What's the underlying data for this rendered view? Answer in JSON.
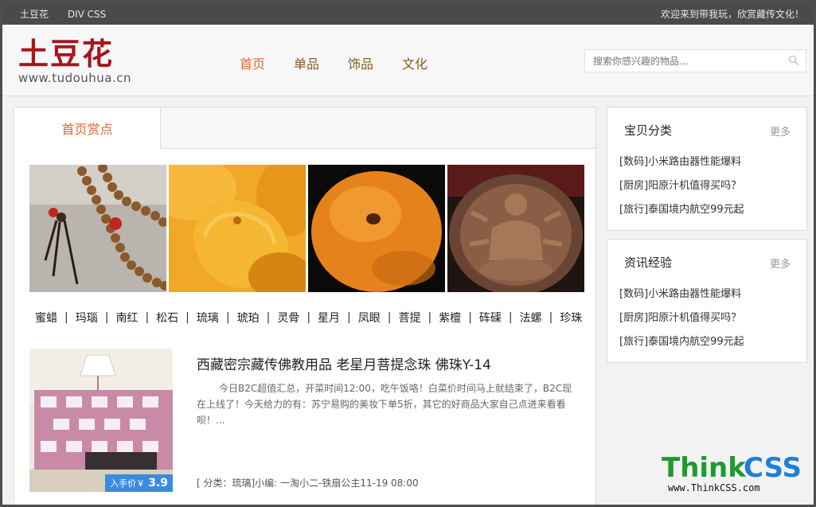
{
  "topbar": {
    "links": [
      "土豆花",
      "DIV CSS"
    ],
    "welcome": "欢迎来到带我玩，欣赏藏传文化！"
  },
  "logo": {
    "title": "土豆花",
    "url": "www.tudouhua.cn"
  },
  "nav": [
    "首页",
    "单品",
    "饰品",
    "文化"
  ],
  "search": {
    "placeholder": "搜索你感兴趣的物品..."
  },
  "main": {
    "tab": "首页赏点",
    "gallery": [
      {
        "name": "beads-mala-image"
      },
      {
        "name": "amber-pendant-image"
      },
      {
        "name": "orange-bead-image"
      },
      {
        "name": "buddha-carving-image"
      }
    ],
    "tags": [
      "蜜蜡",
      "玛瑙",
      "南红",
      "松石",
      "琉璃",
      "琥珀",
      "灵骨",
      "星月",
      "凤眼",
      "菩提",
      "紫檀",
      "砗磲",
      "法螺",
      "珍珠"
    ],
    "article": {
      "title": "西藏密宗藏传佛教用品 老星月菩提念珠 佛珠Y-14",
      "desc": "今日B2C超值汇总，开菜时间12:00，吃午饭咯！白菜价时间马上就结束了，B2C现在上线了！今天给力的有：苏宁易购的美妆下单5折，其它的好商品大家自己点进来看看呗！...",
      "price_label": "入手价￥",
      "price": "3.9",
      "meta": "[ 分类：琉璃]小编: 一淘小二-铁扇公主11-19 08:00"
    }
  },
  "sidebar": {
    "boxes": [
      {
        "title": "宝贝分类",
        "more": "更多",
        "items": [
          "[数码]小米路由器性能爆料",
          "[厨房]阳原汁机值得买吗？",
          "[旅行]泰国境内航空99元起"
        ]
      },
      {
        "title": "资讯经验",
        "more": "更多",
        "items": [
          "[数码]小米路由器性能爆料",
          "[厨房]阳原汁机值得买吗？",
          "[旅行]泰国境内航空99元起"
        ]
      }
    ]
  },
  "watermark": {
    "think": "Think",
    "css": "CSS",
    "url": "www.ThinkCSS.com"
  },
  "colors": {
    "brand": "#a8151b",
    "accent": "#e0682a",
    "price_badge": "#3a8be0",
    "topbar": "#4a4a4a"
  }
}
